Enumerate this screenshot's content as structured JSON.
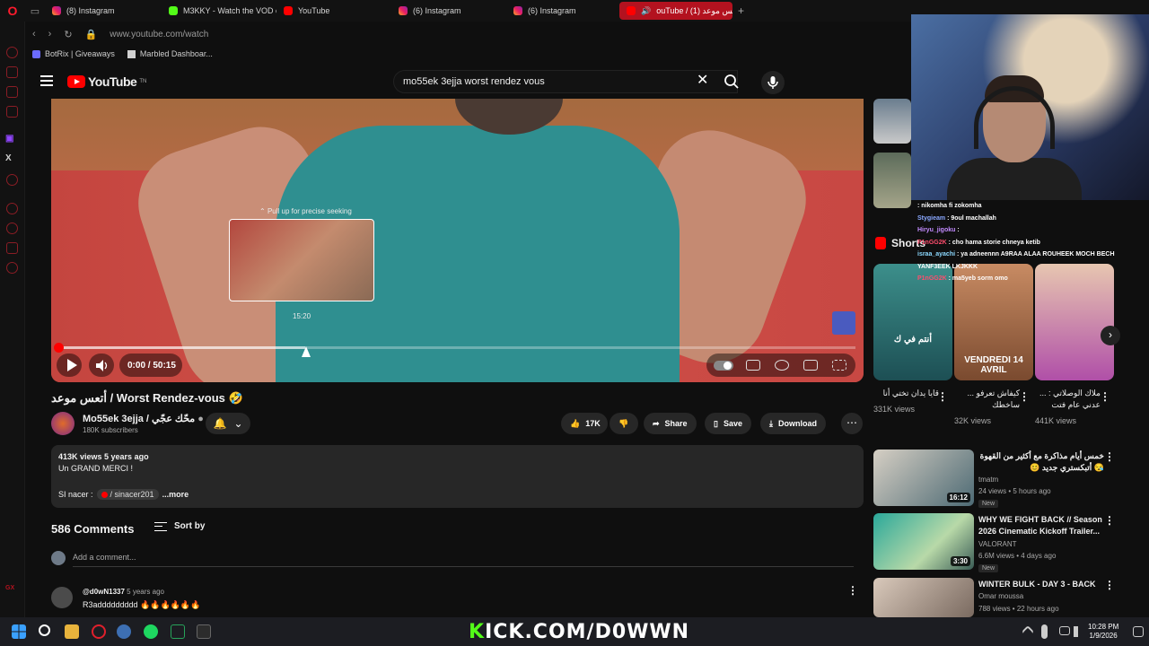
{
  "browser": {
    "tabs": [
      {
        "label": "(8) Instagram",
        "icon": "instagram-icon"
      },
      {
        "label": "M3KKY - Watch the VOD o",
        "icon": "kick-icon"
      },
      {
        "label": "YouTube",
        "icon": "youtube-icon"
      },
      {
        "label": "(6) Instagram",
        "icon": "instagram-icon"
      },
      {
        "label": "(6) Instagram",
        "icon": "instagram-icon"
      },
      {
        "label": "ouTube / أتعس موعد (1)",
        "icon": "youtube-icon",
        "active": true
      }
    ],
    "new_tab": "+",
    "url": "www.youtube.com/watch",
    "bookmarks": [
      "BotRix | Giveaways",
      "Marbled Dashboar..."
    ]
  },
  "youtube": {
    "logo": "YouTube",
    "logo_country": "TN",
    "search_value": "mo55ek 3ejja worst rendez vous"
  },
  "player": {
    "seek_hint": "Pull up for precise seeking",
    "seek_time": "15:20",
    "time_display": "0:00 / 50:15",
    "played_fraction": 0.0,
    "hover_fraction": 0.31
  },
  "video": {
    "title": "أتعس موعد / Worst Rendez-vous 🤣",
    "channel_name": "Mo55ek 3ejja / محّك عجّي",
    "subscribers": "180K subscribers",
    "likes": "17K",
    "share_label": "Share",
    "save_label": "Save",
    "download_label": "Download",
    "views_date": "413K views  5 years ago",
    "desc_line1": "Un GRAND MERCI !",
    "desc_prefix": "SI nacer :",
    "desc_chip": "/ sinacer201",
    "desc_more": "...more"
  },
  "comments": {
    "count_label": "586 Comments",
    "sort_label": "Sort by",
    "add_placeholder": "Add a comment...",
    "first_author": "@d0wN1337",
    "first_time": "5 years ago",
    "first_text": "R3addddddddd 🔥🔥🔥🔥🔥🔥"
  },
  "shorts": {
    "header": "Shorts",
    "items": [
      {
        "title": "قايا يدان تختي أنا",
        "views": "331K views",
        "overlay": "أنتم في ك"
      },
      {
        "title": "كيفاش تعرفو ... ساخطك",
        "views": "32K views",
        "overlay": "VENDREDI 14 AVRIL"
      },
      {
        "title": "ملاك الوصلاتي : ... عدني عام فتت",
        "views": "441K views",
        "overlay": ""
      }
    ]
  },
  "related": [
    {
      "title": "خمس أيام مذاكرة مع أكثير من القهوة 😪 أتبكستري جديد 😊",
      "channel": "tmatm",
      "meta": "24 views • 5 hours ago",
      "duration": "16:12",
      "badge": "New"
    },
    {
      "title": "WHY WE FIGHT BACK // Season 2026 Cinematic Kickoff Trailer...",
      "channel": "VALORANT",
      "meta": "6.6M views • 4 days ago",
      "duration": "3:30",
      "badge": "New"
    },
    {
      "title": "WINTER BULK - DAY 3 - BACK",
      "channel": "Omar moussa",
      "meta": "788 views • 22 hours ago",
      "duration": "",
      "badge": ""
    }
  ],
  "stream_chat": [
    {
      "user": "",
      "text": ": nikomha fi zokomha",
      "color": "#8aa8ff"
    },
    {
      "user": "Stygieam",
      "text": ": 9oul machallah",
      "color": "#8aa8ff"
    },
    {
      "user": "Hiryu_jigoku",
      "text": ":",
      "color": "#c38bff"
    },
    {
      "user": "P1nGG2K",
      "text": ": cho hama storie chneya ketib",
      "color": "#ff4d6d"
    },
    {
      "user": "israa_ayachi",
      "text": ": ya adneennn A9RAA ALAA ROUHEEK MOCH BECH",
      "color": "#8cd9ff"
    },
    {
      "user": "",
      "text": "YANF3EEK LKJKKK",
      "color": "#ffffff"
    },
    {
      "user": "P1nGG2K",
      "text": ": ma5yeb sorm omo",
      "color": "#ff4d6d"
    }
  ],
  "stream_watermark": {
    "prefix": "K",
    "rest": "ICK.COM/D0WWN"
  },
  "taskbar": {
    "time": "10:28 PM",
    "date": "1/9/2026"
  },
  "colors": {
    "yt_red": "#ff0000",
    "kick_green": "#53fc18",
    "opera_red": "#ff1b2d"
  }
}
